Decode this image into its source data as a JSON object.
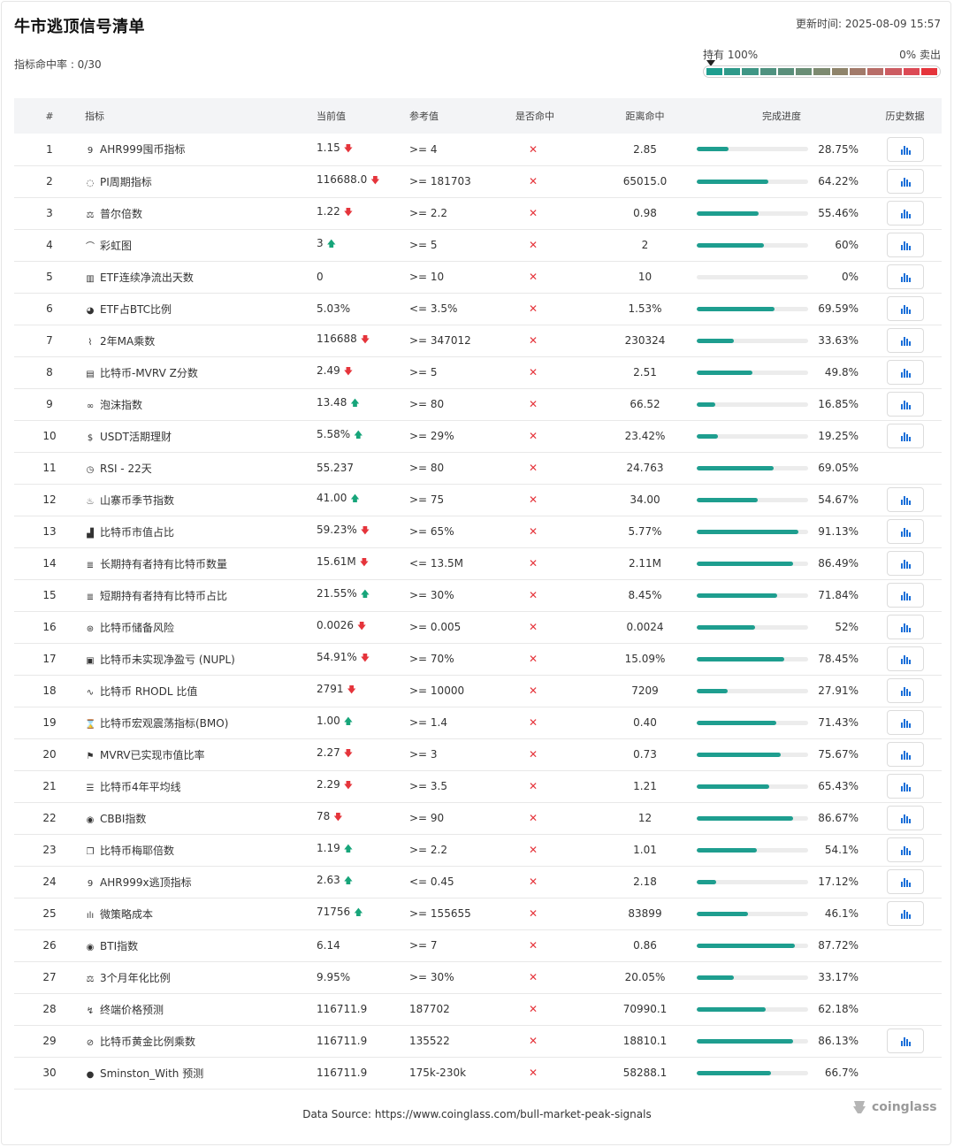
{
  "header": {
    "title": "牛市逃顶信号清单",
    "hit_rate": "指标命中率 : 0/30",
    "updated": "更新时间: 2025-08-09 15:57",
    "hold_label": "持有 100%",
    "sell_label": "0% 卖出",
    "gauge_level": 0,
    "gauge_colors": [
      "#1e9e8f",
      "#2f9a8a",
      "#3f9685",
      "#4f9280",
      "#5a8f7b",
      "#6a8e76",
      "#7d8a70",
      "#8f846b",
      "#a27a6a",
      "#b86d68",
      "#cc5c62",
      "#dc4a55",
      "#e5343b"
    ]
  },
  "table": {
    "headers": [
      "#",
      "指标",
      "当前值",
      "参考值",
      "是否命中",
      "距离命中",
      "完成进度",
      "历史数据"
    ],
    "rows": [
      {
        "n": "1",
        "icon": "9",
        "name": "AHR999囤币指标",
        "cur": "1.15",
        "dir": "down",
        "ref": ">= 4",
        "dist": "2.85",
        "p": 28.75,
        "ptxt": "28.75%",
        "hist": true
      },
      {
        "n": "2",
        "icon": "◌",
        "name": "PI周期指标",
        "cur": "116688.0",
        "dir": "down",
        "ref": ">= 181703",
        "dist": "65015.0",
        "p": 64.22,
        "ptxt": "64.22%",
        "hist": true
      },
      {
        "n": "3",
        "icon": "⚖",
        "name": "普尔倍数",
        "cur": "1.22",
        "dir": "down",
        "ref": ">= 2.2",
        "dist": "0.98",
        "p": 55.46,
        "ptxt": "55.46%",
        "hist": true
      },
      {
        "n": "4",
        "icon": "⌒",
        "name": "彩虹图",
        "cur": "3",
        "dir": "up",
        "ref": ">= 5",
        "dist": "2",
        "p": 60,
        "ptxt": "60%",
        "hist": true
      },
      {
        "n": "5",
        "icon": "▥",
        "name": "ETF连续净流出天数",
        "cur": "0",
        "dir": "",
        "ref": ">= 10",
        "dist": "10",
        "p": 0,
        "ptxt": "0%",
        "hist": true
      },
      {
        "n": "6",
        "icon": "◕",
        "name": "ETF占BTC比例",
        "cur": "5.03%",
        "dir": "",
        "ref": "<= 3.5%",
        "dist": "1.53%",
        "p": 69.59,
        "ptxt": "69.59%",
        "hist": true
      },
      {
        "n": "7",
        "icon": "⌇",
        "name": "2年MA乘数",
        "cur": "116688",
        "dir": "down",
        "ref": ">= 347012",
        "dist": "230324",
        "p": 33.63,
        "ptxt": "33.63%",
        "hist": true
      },
      {
        "n": "8",
        "icon": "▤",
        "name": "比特币-MVRV Z分数",
        "cur": "2.49",
        "dir": "down",
        "ref": ">= 5",
        "dist": "2.51",
        "p": 49.8,
        "ptxt": "49.8%",
        "hist": true
      },
      {
        "n": "9",
        "icon": "∞",
        "name": "泡沫指数",
        "cur": "13.48",
        "dir": "up",
        "ref": ">= 80",
        "dist": "66.52",
        "p": 16.85,
        "ptxt": "16.85%",
        "hist": true
      },
      {
        "n": "10",
        "icon": "$",
        "name": "USDT活期理财",
        "cur": "5.58%",
        "dir": "up",
        "ref": ">= 29%",
        "dist": "23.42%",
        "p": 19.25,
        "ptxt": "19.25%",
        "hist": true
      },
      {
        "n": "11",
        "icon": "◷",
        "name": "RSI - 22天",
        "cur": "55.237",
        "dir": "",
        "ref": ">= 80",
        "dist": "24.763",
        "p": 69.05,
        "ptxt": "69.05%",
        "hist": false
      },
      {
        "n": "12",
        "icon": "♨",
        "name": "山寨币季节指数",
        "cur": "41.00",
        "dir": "up",
        "ref": ">= 75",
        "dist": "34.00",
        "p": 54.67,
        "ptxt": "54.67%",
        "hist": true
      },
      {
        "n": "13",
        "icon": "▟",
        "name": "比特币市值占比",
        "cur": "59.23%",
        "dir": "down",
        "ref": ">= 65%",
        "dist": "5.77%",
        "p": 91.13,
        "ptxt": "91.13%",
        "hist": true
      },
      {
        "n": "14",
        "icon": "≣",
        "name": "长期持有者持有比特币数量",
        "cur": "15.61M",
        "dir": "down",
        "ref": "<= 13.5M",
        "dist": "2.11M",
        "p": 86.49,
        "ptxt": "86.49%",
        "hist": true
      },
      {
        "n": "15",
        "icon": "≣",
        "name": "短期持有者持有比特币占比",
        "cur": "21.55%",
        "dir": "up",
        "ref": ">= 30%",
        "dist": "8.45%",
        "p": 71.84,
        "ptxt": "71.84%",
        "hist": true
      },
      {
        "n": "16",
        "icon": "⊛",
        "name": "比特币储备风险",
        "cur": "0.0026",
        "dir": "down",
        "ref": ">= 0.005",
        "dist": "0.0024",
        "p": 52,
        "ptxt": "52%",
        "hist": true
      },
      {
        "n": "17",
        "icon": "▣",
        "name": "比特币未实现净盈亏 (NUPL)",
        "cur": "54.91%",
        "dir": "down",
        "ref": ">= 70%",
        "dist": "15.09%",
        "p": 78.45,
        "ptxt": "78.45%",
        "hist": true
      },
      {
        "n": "18",
        "icon": "∿",
        "name": "比特币 RHODL 比值",
        "cur": "2791",
        "dir": "down",
        "ref": ">= 10000",
        "dist": "7209",
        "p": 27.91,
        "ptxt": "27.91%",
        "hist": true
      },
      {
        "n": "19",
        "icon": "⌛",
        "name": "比特币宏观震荡指标(BMO)",
        "cur": "1.00",
        "dir": "up",
        "ref": ">= 1.4",
        "dist": "0.40",
        "p": 71.43,
        "ptxt": "71.43%",
        "hist": true
      },
      {
        "n": "20",
        "icon": "⚑",
        "name": "MVRV已实现市值比率",
        "cur": "2.27",
        "dir": "down",
        "ref": ">= 3",
        "dist": "0.73",
        "p": 75.67,
        "ptxt": "75.67%",
        "hist": true
      },
      {
        "n": "21",
        "icon": "☰",
        "name": "比特币4年平均线",
        "cur": "2.29",
        "dir": "down",
        "ref": ">= 3.5",
        "dist": "1.21",
        "p": 65.43,
        "ptxt": "65.43%",
        "hist": true
      },
      {
        "n": "22",
        "icon": "◉",
        "name": "CBBI指数",
        "cur": "78",
        "dir": "down",
        "ref": ">= 90",
        "dist": "12",
        "p": 86.67,
        "ptxt": "86.67%",
        "hist": true
      },
      {
        "n": "23",
        "icon": "❐",
        "name": "比特币梅耶倍数",
        "cur": "1.19",
        "dir": "up",
        "ref": ">= 2.2",
        "dist": "1.01",
        "p": 54.1,
        "ptxt": "54.1%",
        "hist": true
      },
      {
        "n": "24",
        "icon": "9",
        "name": "AHR999x逃顶指标",
        "cur": "2.63",
        "dir": "up",
        "ref": "<= 0.45",
        "dist": "2.18",
        "p": 17.12,
        "ptxt": "17.12%",
        "hist": true
      },
      {
        "n": "25",
        "icon": "ılı",
        "name": "微策略成本",
        "cur": "71756",
        "dir": "up",
        "ref": ">= 155655",
        "dist": "83899",
        "p": 46.1,
        "ptxt": "46.1%",
        "hist": true
      },
      {
        "n": "26",
        "icon": "◉",
        "name": "BTI指数",
        "cur": "6.14",
        "dir": "",
        "ref": ">= 7",
        "dist": "0.86",
        "p": 87.72,
        "ptxt": "87.72%",
        "hist": false
      },
      {
        "n": "27",
        "icon": "⚖",
        "name": "3个月年化比例",
        "cur": "9.95%",
        "dir": "",
        "ref": ">= 30%",
        "dist": "20.05%",
        "p": 33.17,
        "ptxt": "33.17%",
        "hist": false
      },
      {
        "n": "28",
        "icon": "↯",
        "name": "终端价格预测",
        "cur": "116711.9",
        "dir": "",
        "ref": "187702",
        "dist": "70990.1",
        "p": 62.18,
        "ptxt": "62.18%",
        "hist": false
      },
      {
        "n": "29",
        "icon": "⊘",
        "name": "比特币黄金比例乘数",
        "cur": "116711.9",
        "dir": "",
        "ref": "135522",
        "dist": "18810.1",
        "p": 86.13,
        "ptxt": "86.13%",
        "hist": true
      },
      {
        "n": "30",
        "icon": "●",
        "name": "Sminston_With 预测",
        "cur": "116711.9",
        "dir": "",
        "ref": "175k-230k",
        "dist": "58288.1",
        "p": 66.7,
        "ptxt": "66.7%",
        "hist": false
      }
    ]
  },
  "footer": {
    "source": "Data Source: https://www.coinglass.com/bull-market-peak-signals",
    "logo": "coinglass"
  },
  "colors": {
    "progress": "#1e9e8f",
    "down": "#e5343b",
    "up": "#17a57a",
    "chart_icon": "#1a6fd8"
  },
  "icons": {
    "down": "arrow-down-icon",
    "up": "arrow-up-icon",
    "miss": "cross-icon",
    "history": "bar-chart-icon"
  }
}
